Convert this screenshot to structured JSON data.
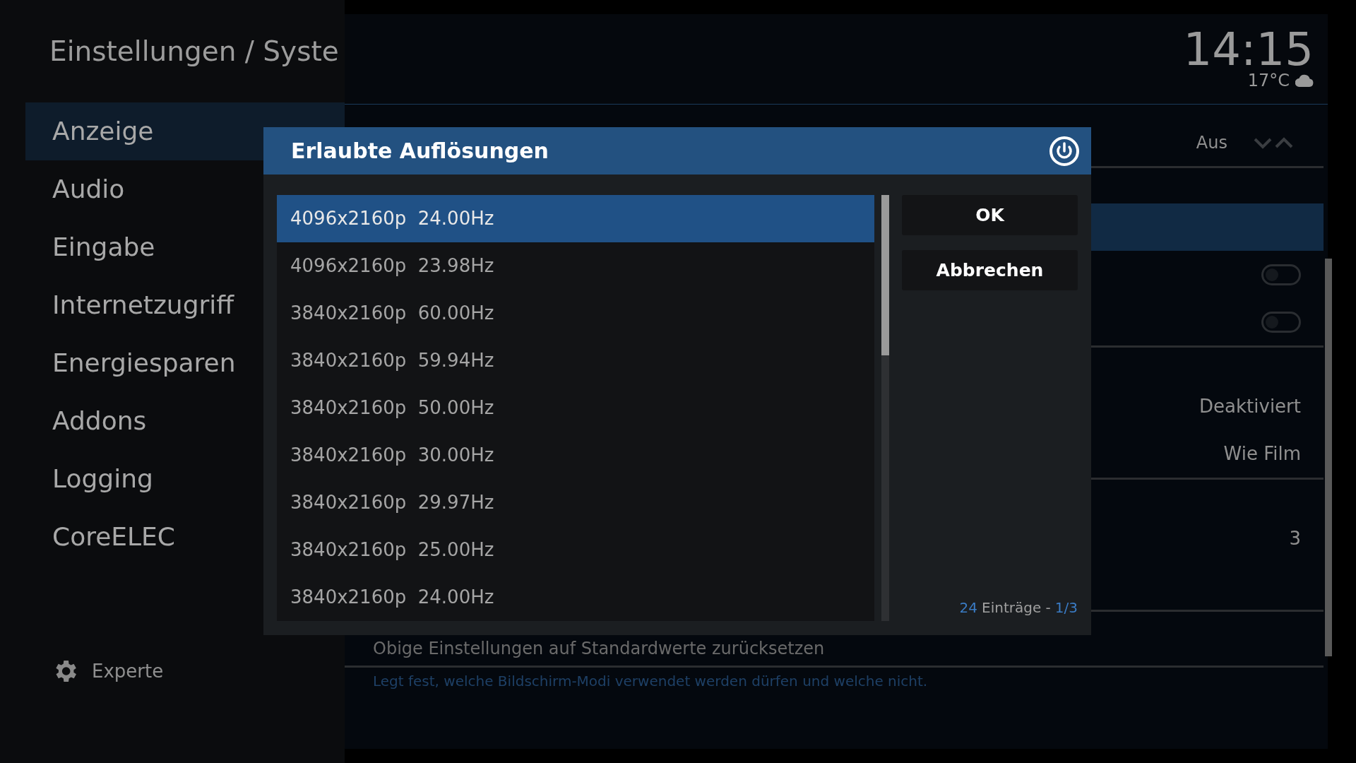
{
  "header": {
    "title": "Einstellungen / Syste",
    "clock": "14:15",
    "weather": "17°C"
  },
  "sidebar": {
    "items": [
      {
        "label": "Anzeige",
        "selected": true
      },
      {
        "label": "Audio",
        "selected": false
      },
      {
        "label": "Eingabe",
        "selected": false
      },
      {
        "label": "Internetzugriff",
        "selected": false
      },
      {
        "label": "Energiesparen",
        "selected": false
      },
      {
        "label": "Addons",
        "selected": false
      },
      {
        "label": "Logging",
        "selected": false
      },
      {
        "label": "CoreELEC",
        "selected": false
      }
    ],
    "level_button": "Experte"
  },
  "settings": {
    "groups": [
      [
        {
          "kind": "spinner",
          "value": "Aus",
          "selected": false
        }
      ],
      [
        {
          "kind": "empty",
          "selected": true
        },
        {
          "kind": "toggle",
          "on": false,
          "selected": false
        },
        {
          "kind": "toggle",
          "on": false,
          "selected": false
        }
      ],
      [
        {
          "kind": "value",
          "value": "Deaktiviert",
          "selected": false
        },
        {
          "kind": "value",
          "value": "Wie Film",
          "selected": false
        }
      ],
      [
        {
          "kind": "value",
          "value": "3",
          "selected": false
        },
        {
          "kind": "empty",
          "selected": false
        }
      ],
      [
        {
          "kind": "action",
          "label": "Obige Einstellungen auf Standardwerte zurücksetzen",
          "selected": false
        }
      ]
    ],
    "description": "Legt fest, welche Bildschirm-Modi verwendet werden dürfen und welche nicht."
  },
  "dialog": {
    "title": "Erlaubte Auflösungen",
    "items": [
      {
        "label": "4096x2160p  24.00Hz",
        "selected": true
      },
      {
        "label": "4096x2160p  23.98Hz",
        "selected": false
      },
      {
        "label": "3840x2160p  60.00Hz",
        "selected": false
      },
      {
        "label": "3840x2160p  59.94Hz",
        "selected": false
      },
      {
        "label": "3840x2160p  50.00Hz",
        "selected": false
      },
      {
        "label": "3840x2160p  30.00Hz",
        "selected": false
      },
      {
        "label": "3840x2160p  29.97Hz",
        "selected": false
      },
      {
        "label": "3840x2160p  25.00Hz",
        "selected": false
      },
      {
        "label": "3840x2160p  24.00Hz",
        "selected": false
      }
    ],
    "buttons": [
      {
        "label": "OK",
        "selected": false
      },
      {
        "label": "Abbrechen",
        "selected": false
      }
    ],
    "footer": {
      "count": "24",
      "label": "Einträge -",
      "page": "1/3"
    }
  }
}
